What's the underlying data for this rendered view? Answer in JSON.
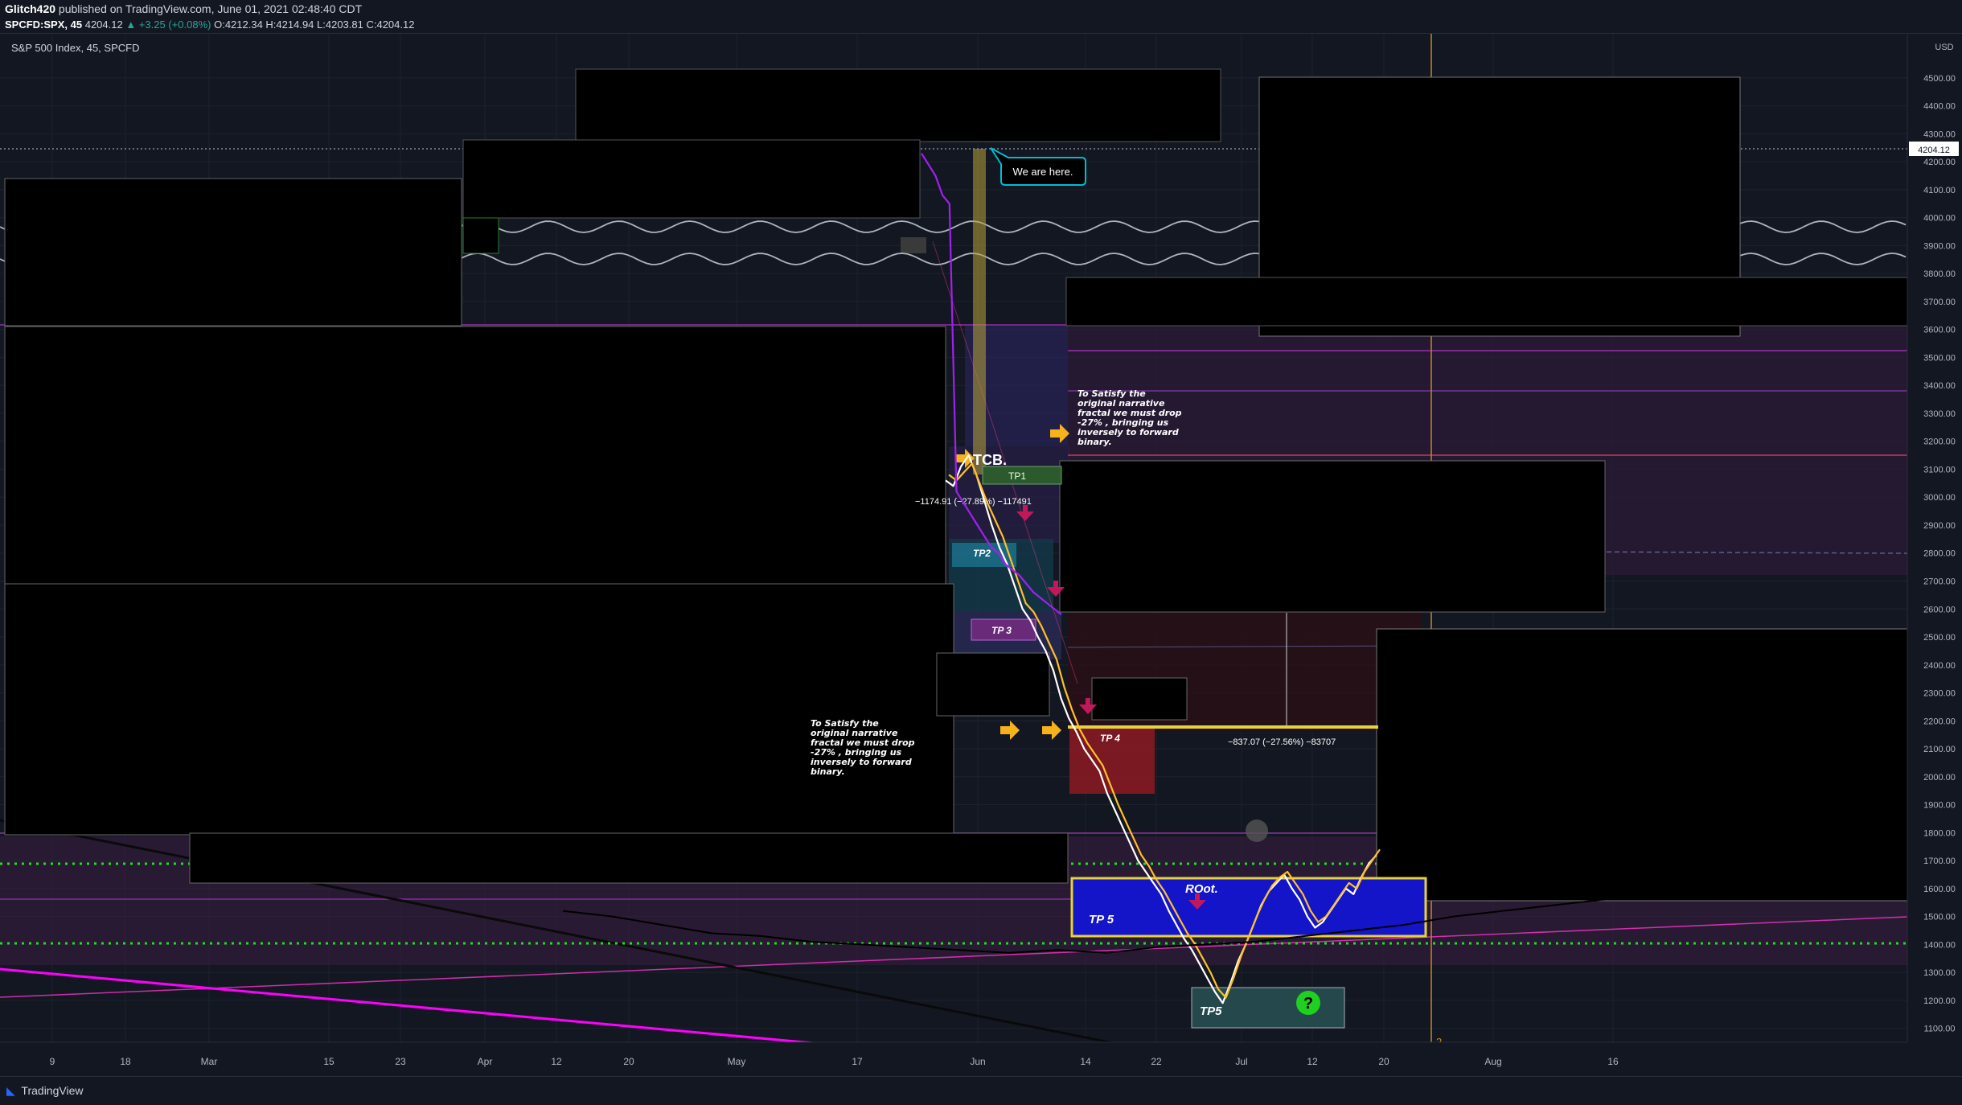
{
  "header": {
    "publisher": "Glitch420",
    "published_text": "published on TradingView.com, June 01, 2021 02:48:40 CDT",
    "symbol_line": "SPCFD:SPX, 45",
    "last": "4204.12",
    "change": "+3.25 (+0.08%)",
    "ohlc": "O:4212.34 H:4214.94 L:4203.81 C:4204.12"
  },
  "footer": {
    "brand": "TradingView"
  },
  "notes": {
    "right": "To Satisfy the original narrative fractal we must drop -27% , bringing us inversely to forward binary.",
    "left": "To Satisfy the original narrative fractal we must drop -27% , bringing us inversely to forward binary."
  },
  "chart_data": {
    "type": "line",
    "title": "S&P 500 Index, 45, SPCFD",
    "currency": "USD",
    "last_price": "4204.12",
    "ylim": [
      1050,
      4560
    ],
    "y_ticks": [
      "4500.00",
      "4400.00",
      "4300.00",
      "4200.00",
      "4100.00",
      "4000.00",
      "3900.00",
      "3800.00",
      "3700.00",
      "3600.00",
      "3500.00",
      "3400.00",
      "3300.00",
      "3200.00",
      "3100.00",
      "3000.00",
      "2900.00",
      "2800.00",
      "2700.00",
      "2600.00",
      "2500.00",
      "2400.00",
      "2300.00",
      "2200.00",
      "2100.00",
      "2000.00",
      "1900.00",
      "1800.00",
      "1700.00",
      "1600.00",
      "1500.00",
      "1400.00",
      "1300.00",
      "1200.00",
      "1100.00"
    ],
    "x_ticks": [
      "9",
      "18",
      "Mar",
      "15",
      "23",
      "Apr",
      "12",
      "20",
      "May",
      "17",
      "Jun",
      "14",
      "22",
      "Jul",
      "12",
      "20",
      "Aug",
      "16"
    ],
    "vertical_marker_label": "2",
    "annotations": {
      "callout": "We are here.",
      "tcb": "TCB.",
      "tp1": "TP1",
      "tp2": "TP2",
      "tp3": "TP 3",
      "tp4": "TP 4",
      "tp5": "TP 5",
      "tp5_lower": "TP5",
      "root": "ROot.",
      "measure_1": "−1174.91 (−27.89%) −117491",
      "measure_2": "−837.07 (−27.56%) −83707",
      "question": "?"
    },
    "series": [
      {
        "color": "#ffffff",
        "x": [
          0,
          1,
          2,
          3,
          4,
          5,
          6,
          7,
          8,
          9,
          10,
          11,
          12,
          13,
          14,
          15,
          16,
          17,
          18,
          19,
          20,
          21,
          22,
          23,
          24,
          25,
          26,
          27,
          28,
          29,
          30,
          31,
          32,
          33,
          34,
          35,
          36,
          37,
          38,
          39,
          40,
          41,
          42,
          43,
          44,
          45,
          46,
          47,
          48,
          49,
          50,
          51,
          52,
          53,
          54,
          55,
          56
        ],
        "values": [
          3060,
          3040,
          3110,
          3150,
          3080,
          2990,
          2900,
          2820,
          2760,
          2680,
          2600,
          2560,
          2500,
          2450,
          2380,
          2280,
          2210,
          2160,
          2100,
          2060,
          2020,
          1940,
          1880,
          1820,
          1760,
          1700,
          1660,
          1620,
          1580,
          1520,
          1470,
          1420,
          1380,
          1330,
          1280,
          1230,
          1190,
          1260,
          1340,
          1400,
          1470,
          1540,
          1590,
          1620,
          1650,
          1600,
          1560,
          1500,
          1460,
          1480,
          1520,
          1560,
          1600,
          1580,
          1640,
          1690,
          1720
        ]
      },
      {
        "color": "#ffc125",
        "x": [
          0,
          1,
          2,
          3,
          4,
          5,
          6,
          7,
          8,
          9,
          10,
          11,
          12,
          13,
          14,
          15,
          16,
          17,
          18,
          19,
          20,
          21,
          22,
          23,
          24,
          25,
          26,
          27,
          28,
          29,
          30,
          31,
          32,
          33,
          34,
          35,
          36,
          37,
          38,
          39,
          40,
          41,
          42,
          43,
          44,
          45,
          46,
          47,
          48,
          49,
          50,
          51,
          52,
          53,
          54,
          55,
          56
        ],
        "values": [
          3080,
          3060,
          3090,
          3120,
          3050,
          2980,
          2920,
          2860,
          2780,
          2700,
          2620,
          2590,
          2540,
          2480,
          2420,
          2320,
          2240,
          2170,
          2120,
          2080,
          2040,
          1970,
          1900,
          1840,
          1780,
          1720,
          1680,
          1630,
          1590,
          1540,
          1490,
          1440,
          1400,
          1350,
          1300,
          1240,
          1210,
          1280,
          1360,
          1430,
          1500,
          1560,
          1610,
          1640,
          1660,
          1620,
          1580,
          1520,
          1480,
          1500,
          1540,
          1580,
          1620,
          1600,
          1660,
          1700,
          1740
        ]
      },
      {
        "color": "#a020f0",
        "x": [
          0,
          1,
          2,
          3,
          4,
          5,
          6,
          7,
          8,
          9,
          10,
          11,
          12,
          13,
          14,
          15,
          16,
          17,
          18,
          19,
          20
        ],
        "values": [
          4230,
          4190,
          4150,
          4080,
          4050,
          3020,
          2980,
          2940,
          2900,
          2860,
          2820,
          2800,
          2760,
          2740,
          2720,
          2690,
          2660,
          2640,
          2620,
          2600,
          2580
        ]
      },
      {
        "color": "#000000",
        "x": [
          0,
          1,
          2,
          3,
          4,
          5,
          6,
          7,
          8,
          9,
          10,
          11,
          12,
          13,
          14,
          15,
          16,
          17,
          18,
          19,
          20,
          21,
          22,
          23,
          24,
          25,
          26
        ],
        "values": [
          1520,
          1500,
          1470,
          1440,
          1430,
          1410,
          1400,
          1390,
          1380,
          1370,
          1380,
          1370,
          1390,
          1400,
          1410,
          1430,
          1450,
          1470,
          1500,
          1520,
          1540,
          1560,
          1570,
          1580,
          1590,
          1600,
          1610
        ]
      }
    ],
    "horizontal_levels": [
      1712,
      1440,
      4204.12
    ],
    "zones": [
      {
        "label": "TP1",
        "from": 3020,
        "to": 3130
      },
      {
        "label": "TP2",
        "from": 2680,
        "to": 2840
      },
      {
        "label": "TP 3",
        "from": 2470,
        "to": 2570
      },
      {
        "label": "TP 4",
        "from": 1990,
        "to": 2200
      },
      {
        "label": "TP 5",
        "from": 1460,
        "to": 1670
      }
    ]
  }
}
